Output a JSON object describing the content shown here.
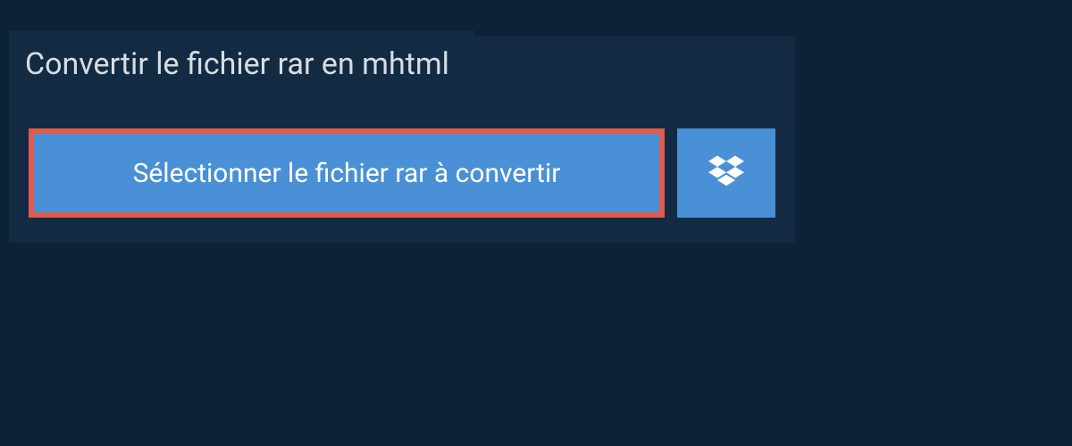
{
  "header": {
    "title": "Convertir le fichier rar en mhtml"
  },
  "actions": {
    "select_file_label": "Sélectionner le fichier rar à convertir",
    "dropbox_icon": "dropbox-icon"
  },
  "colors": {
    "page_bg": "#0c2237",
    "panel_bg": "#122b43",
    "button_bg": "#4990d6",
    "highlight_border": "#e05b4e",
    "text_light": "#ffffff",
    "text_muted": "#d7dde2"
  }
}
